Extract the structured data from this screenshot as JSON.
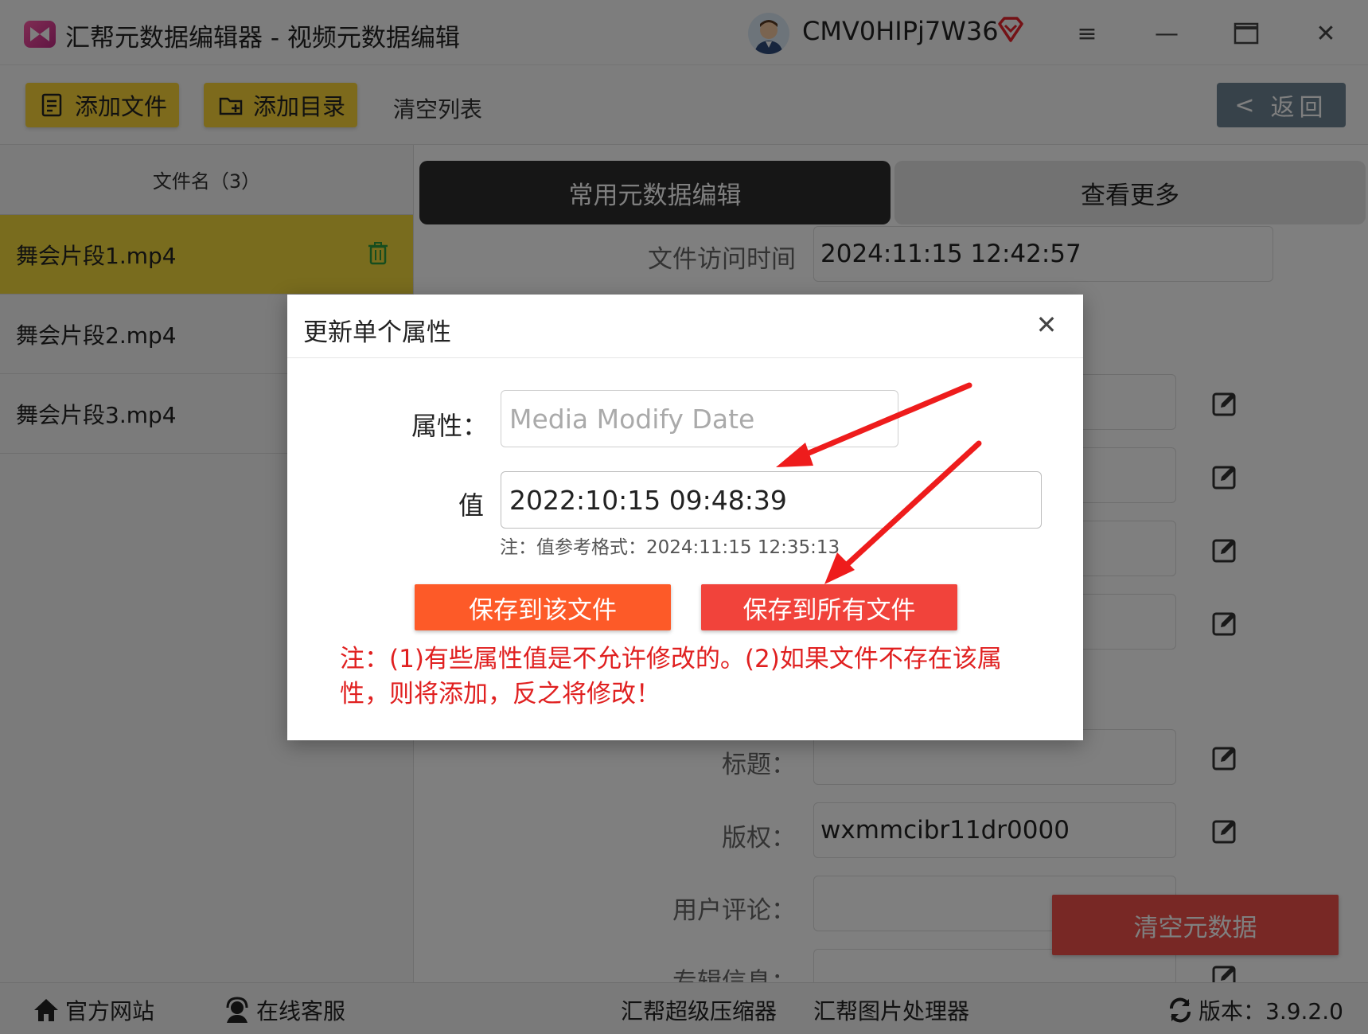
{
  "titlebar": {
    "app_title": "汇帮元数据编辑器 - 视频元数据编辑",
    "username": "CMV0HIPj7W36",
    "menu_glyph": "≡",
    "minimize_glyph": "—",
    "close_glyph": "✕"
  },
  "toolbar": {
    "add_file": "添加文件",
    "add_dir": "添加目录",
    "clear_list": "清空列表",
    "back": "返回",
    "back_glyph": "<"
  },
  "sidebar": {
    "header": "文件名（3）",
    "files": [
      "舞会片段1.mp4",
      "舞会片段2.mp4",
      "舞会片段3.mp4"
    ]
  },
  "tabs": {
    "common": "常用元数据编辑",
    "more": "查看更多"
  },
  "fields": {
    "access_time_label": "文件访问时间",
    "access_time_value": "2024:11:15 12:42:57",
    "title_label": "标题：",
    "title_value": "",
    "copyright_label": "版权：",
    "copyright_value": "wxmmcibr11dr0000",
    "comment_label": "用户评论：",
    "comment_value": "",
    "album_label": "专辑信息："
  },
  "clear_metadata": "清空元数据",
  "footer": {
    "website": "官方网站",
    "support": "在线客服",
    "compressor": "汇帮超级压缩器",
    "image_tool": "汇帮图片处理器",
    "version": "版本：3.9.2.0"
  },
  "modal": {
    "title": "更新单个属性",
    "close_glyph": "✕",
    "attr_label": "属性：",
    "attr_placeholder": "Media Modify Date",
    "value_label": "值",
    "value": "2022:10:15 09:48:39",
    "hint": "注：值参考格式：2024:11:15 12:35:13",
    "save_one": "保存到该文件",
    "save_all": "保存到所有文件",
    "note": "注：(1)有些属性值是不允许修改的。(2)如果文件不存在该属性，则将添加，反之将修改！"
  },
  "colors": {
    "yellow_button": "#fbd538",
    "selected_row": "#f2d93c",
    "back_button": "#6f8594",
    "orange_button": "#fd5a28",
    "red_button": "#f1433b",
    "note_red": "#e02020",
    "arrow_red": "#ee1c1c"
  }
}
